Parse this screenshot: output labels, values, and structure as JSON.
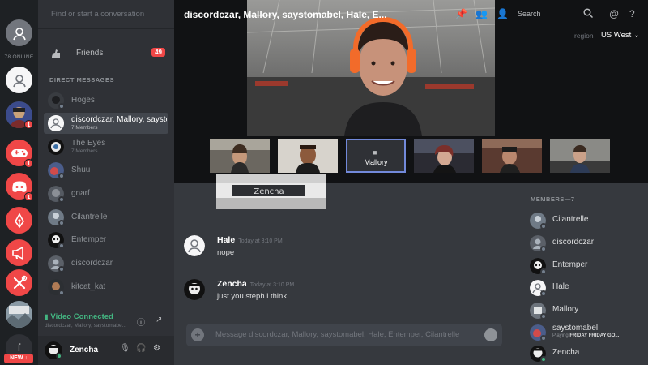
{
  "colors": {
    "rail_bg": "#1e2124",
    "sidebar_bg": "#2f3136",
    "chat_bg": "#36393e",
    "accent": "#7289da",
    "badge_red": "#f04747",
    "online_green": "#43b581"
  },
  "servers": {
    "online_count": "78 ONLINE",
    "items": [
      {
        "name": "Direct Messages",
        "icon": "friends-icon",
        "color": "#72767d"
      },
      {
        "name": "Direct Messages Active",
        "icon": "friends-icon",
        "color": "#f6f6f7"
      },
      {
        "name": "Avatar Server",
        "icon": "avatar-icon",
        "color": "#5865f2",
        "badge": "1"
      },
      {
        "name": "Gaming",
        "icon": "gamepad-icon",
        "color": "#f04747",
        "badge": "1"
      },
      {
        "name": "Discord",
        "icon": "discord-logo-icon",
        "color": "#f04747",
        "badge": "1"
      },
      {
        "name": "Pen",
        "icon": "pen-icon",
        "color": "#f04747"
      },
      {
        "name": "Announcements",
        "icon": "megaphone-icon",
        "color": "#f04747"
      },
      {
        "name": "Tools",
        "icon": "tools-icon",
        "color": "#f04747"
      },
      {
        "name": "Photo Server",
        "icon": "photo-icon",
        "color": "#99aab5"
      },
      {
        "name": "f",
        "icon": "f-letter-icon",
        "color": "#2f3136"
      }
    ],
    "new_label": "NEW ↓"
  },
  "dm": {
    "search_placeholder": "Find or start a conversation",
    "friends_label": "Friends",
    "friends_badge": "49",
    "section_title": "DIRECT MESSAGES",
    "items": [
      {
        "name": "Hoges",
        "sub": ""
      },
      {
        "name": "discordczar, Mallory, saystomabel...",
        "sub": "7 Members"
      },
      {
        "name": "The Eyes",
        "sub": "7 Members"
      },
      {
        "name": "Shuu",
        "sub": ""
      },
      {
        "name": "gnarf",
        "sub": ""
      },
      {
        "name": "Cilantrelle",
        "sub": ""
      },
      {
        "name": "Entemper",
        "sub": ""
      },
      {
        "name": "discordczar",
        "sub": ""
      },
      {
        "name": "kitcat_kat",
        "sub": ""
      }
    ],
    "voice": {
      "title": "Video Connected",
      "sub": "discordczar, Mallory, saystomabe..."
    },
    "user": {
      "name": "Zencha"
    }
  },
  "call": {
    "title": "discordczar, Mallory, saystomabel, Hale, E...",
    "search_placeholder": "Search",
    "region_label": "region",
    "region_value": "US West",
    "selected_tile_label": "Mallory",
    "sub_video_text": "Zencha"
  },
  "chat": {
    "messages": [
      {
        "author": "Hale",
        "timestamp": "Today at 3:10 PM",
        "text": "nope"
      },
      {
        "author": "Zencha",
        "timestamp": "Today at 3:10 PM",
        "text": "just you steph i think"
      }
    ],
    "composer_placeholder": "Message discordczar, Mallory, saystomabel, Hale, Entemper, Cilantrelle"
  },
  "members": {
    "header": "MEMBERS—7",
    "items": [
      {
        "name": "Cilantrelle",
        "game": ""
      },
      {
        "name": "discordczar",
        "game": ""
      },
      {
        "name": "Entemper",
        "game": ""
      },
      {
        "name": "Hale",
        "game": ""
      },
      {
        "name": "Mallory",
        "game": ""
      },
      {
        "name": "saystomabel",
        "game_prefix": "Playing",
        "game": "FRIDAY FRIDAY GO..."
      },
      {
        "name": "Zencha",
        "game": ""
      }
    ]
  }
}
